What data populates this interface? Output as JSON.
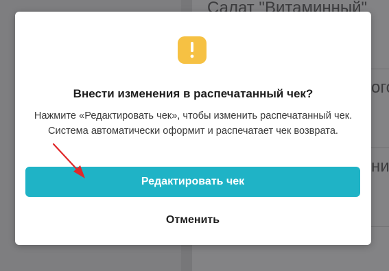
{
  "background": {
    "title_text": "Салат \"Витаминный\"",
    "partial_text_1": "ого",
    "partial_text_2": "ни"
  },
  "modal": {
    "icon": "exclamation-warning-icon",
    "icon_color": "#f6c143",
    "title": "Внести изменения в распечатанный чек?",
    "description": "Нажмите «Редактировать чек», чтобы изменить распечатанный чек. Система автоматически оформит и распечатает чек возврата.",
    "primary_label": "Редактировать чек",
    "primary_color": "#1fb3c6",
    "cancel_label": "Отменить"
  },
  "annotation": {
    "arrow_color": "#e0282a"
  }
}
